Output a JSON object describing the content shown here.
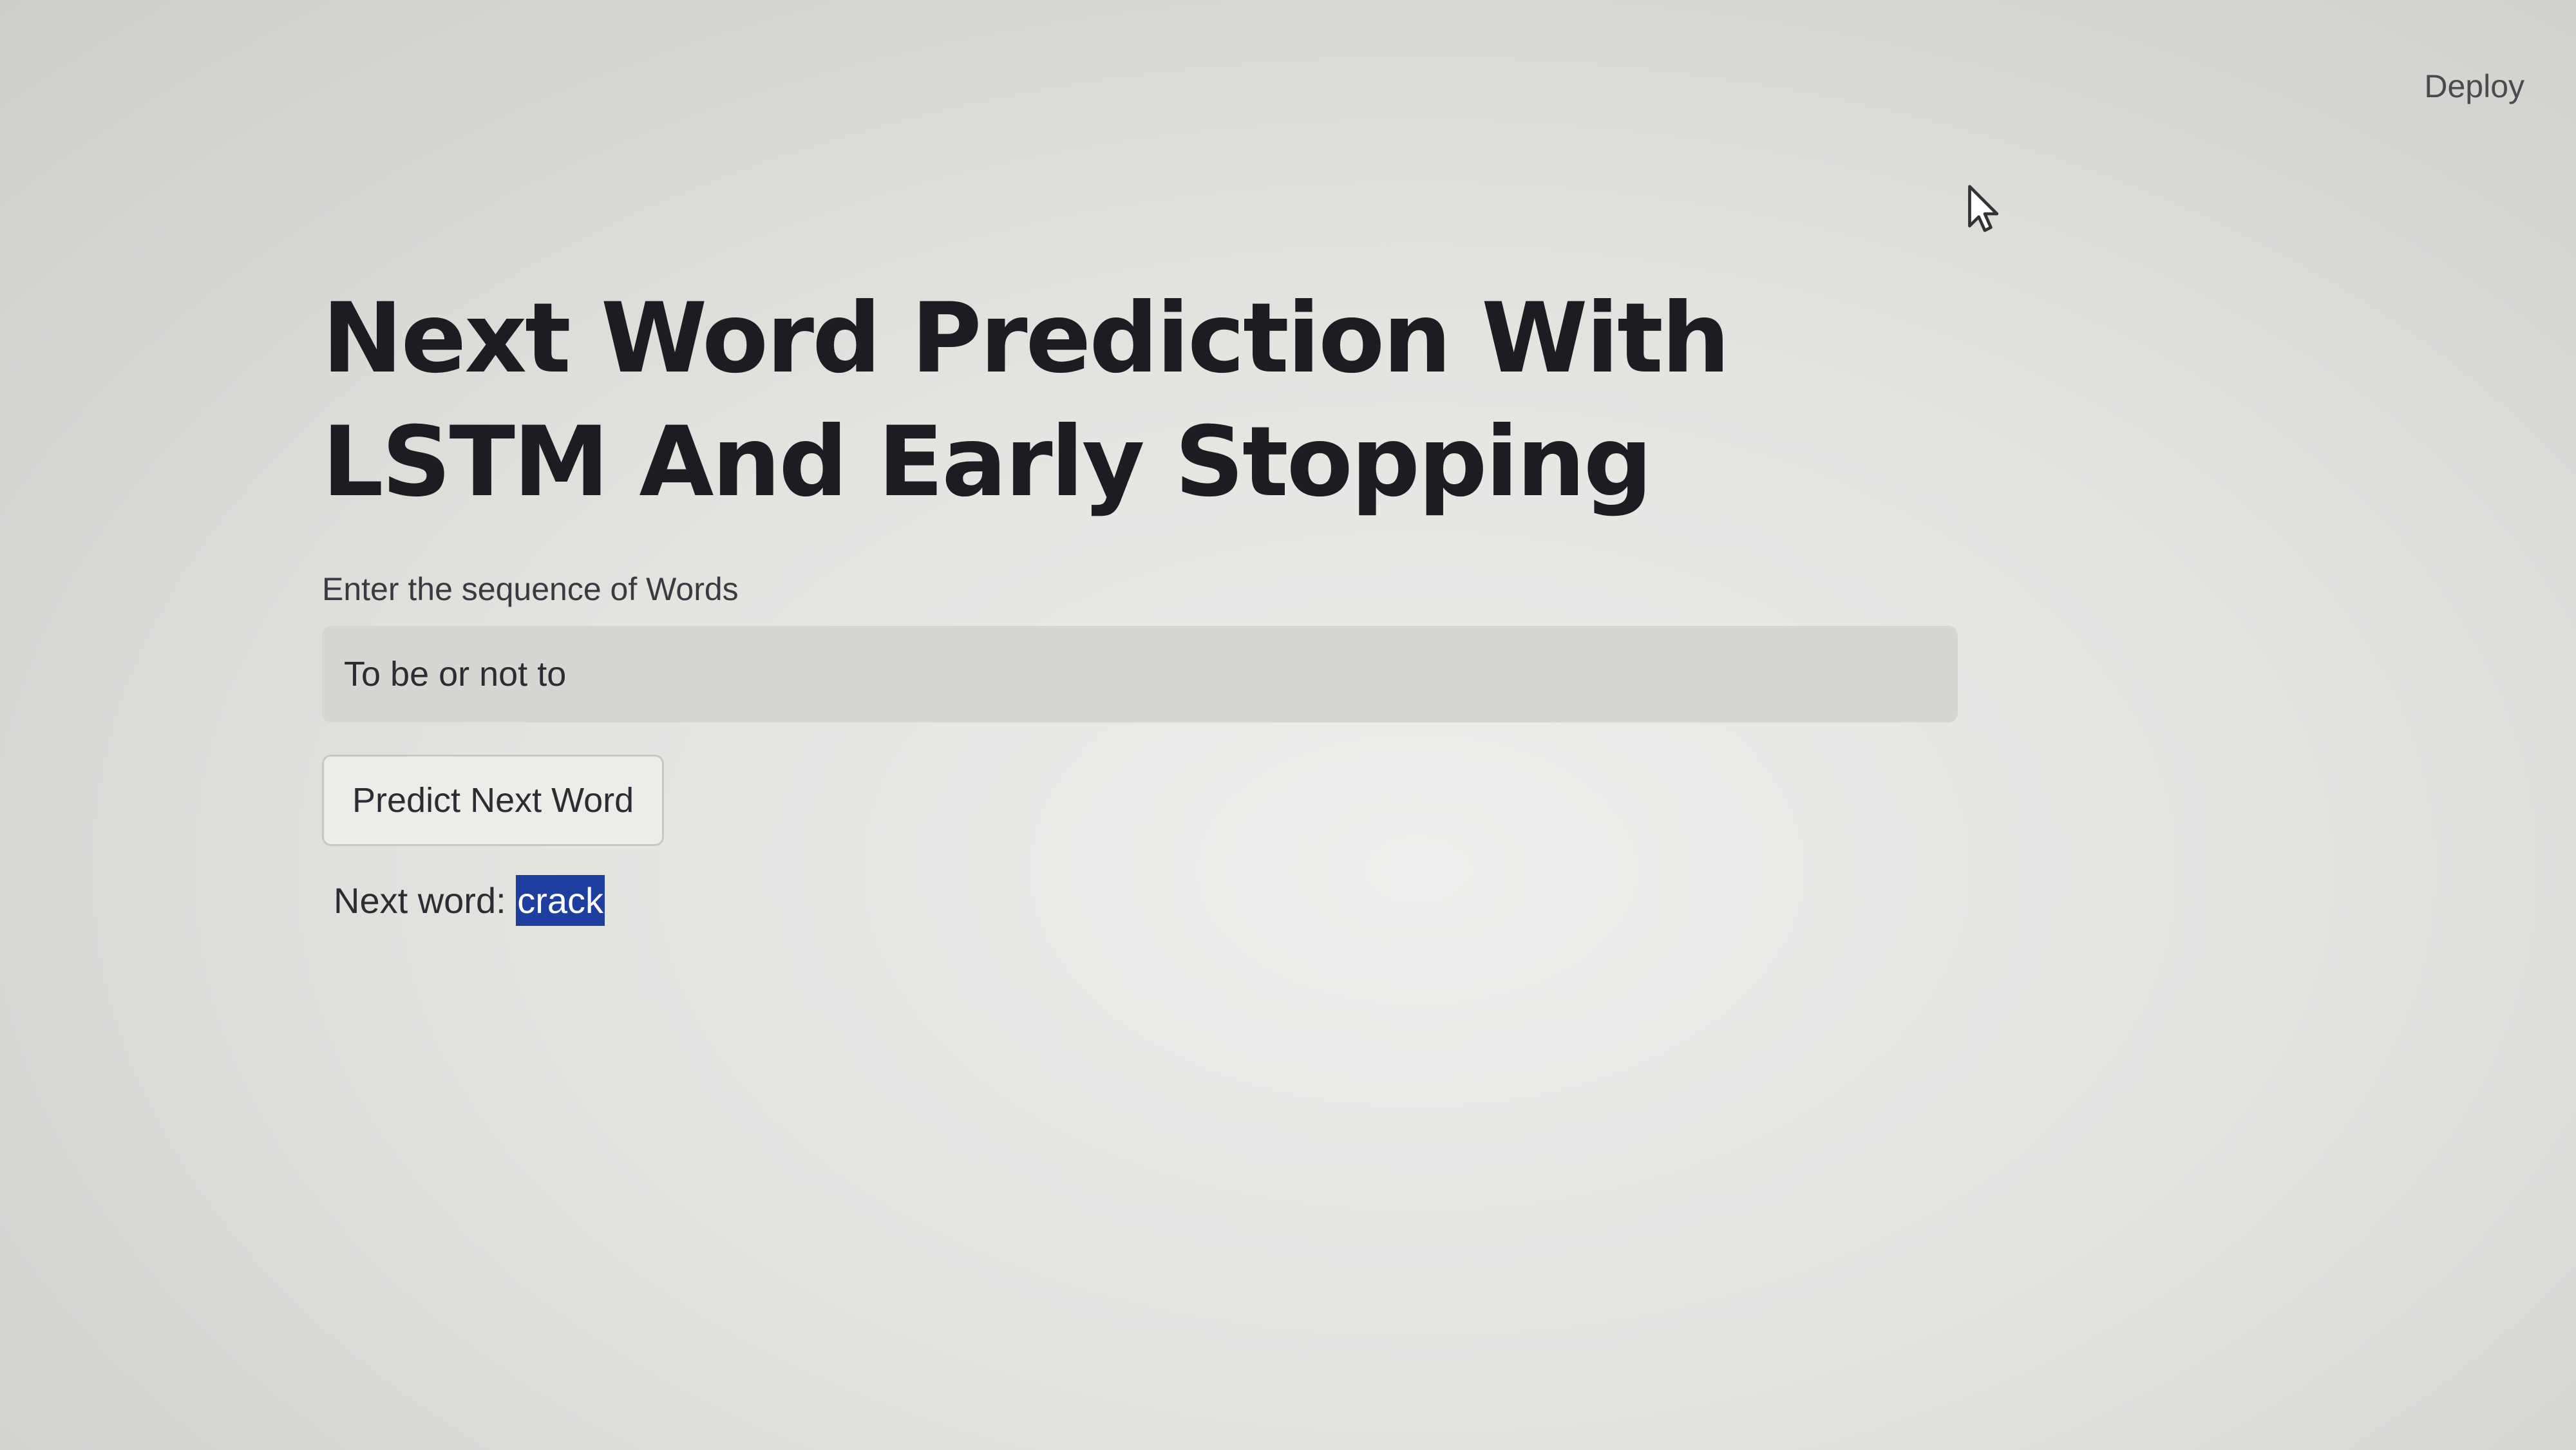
{
  "header": {
    "deploy_label": "Deploy"
  },
  "main": {
    "title": "Next Word Prediction With LSTM And Early Stopping",
    "input": {
      "label": "Enter the sequence of Words",
      "value": "To be or not to"
    },
    "predict_button_label": "Predict Next Word",
    "result": {
      "prefix": "Next word:",
      "word": "crack"
    }
  },
  "colors": {
    "background": "#e3e3e0",
    "highlight": "#1f3fa0",
    "title": "#1c1c22"
  },
  "icons": [
    "mouse-cursor-icon"
  ]
}
